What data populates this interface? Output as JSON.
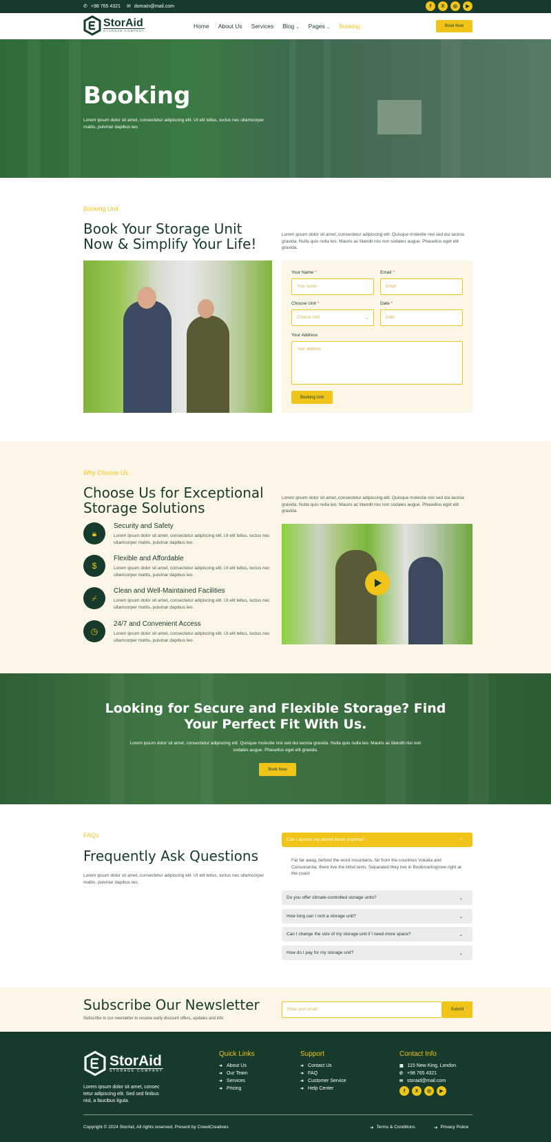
{
  "topbar": {
    "phone": "+98 765 4321",
    "email": "domain@mail.com",
    "social": [
      "facebook-icon",
      "x-icon",
      "instagram-icon",
      "youtube-icon"
    ]
  },
  "brand": {
    "name": "StorAid",
    "tagline": "STORAGE COMPANY"
  },
  "nav": {
    "items": [
      "Home",
      "About Us",
      "Services",
      "Blog",
      "Pages",
      "Booking"
    ],
    "active": "Booking",
    "cta": "Book Now"
  },
  "hero": {
    "title": "Booking",
    "text": "Lorem ipsum dolor sit amet, consectetur adipiscing elit. Ut elit tellus, luctus nec ullamcorper mattis, pulvinar dapibus leo."
  },
  "booking": {
    "kicker": "Booking Unit",
    "title_l1": "Book Your Storage Unit",
    "title_l2": "Now & Simplify Your Life!",
    "text": "Lorem ipsum dolor sit amet, consectetur adipiscing elit. Quisque molestie nisl sed dui lacinia gravida. Nulla quis nulla leo. Mauris ac blandit nisi non sodales augue. Phasellus eget elit gravida.",
    "form": {
      "name_label": "Your Name",
      "name_ph": "Your name",
      "email_label": "Email",
      "email_ph": "Email",
      "unit_label": "Choose Unit",
      "unit_ph": "Choose Unit",
      "date_label": "Date",
      "date_ph": "Date",
      "address_label": "Your Address",
      "address_ph": "Your address",
      "submit": "Booking Unit",
      "req": "*"
    }
  },
  "why": {
    "kicker": "Why Choose Us",
    "title_l1": "Choose Us for Exceptional",
    "title_l2": "Storage Solutions",
    "text": "Lorem ipsum dolor sit amet, consectetur adipiscing elit. Quisque molestie nisl sed dui lacinia gravida. Nulla quis nulla leo. Mauris ac blandit nisi non sodales augue. Phasellus eget elit gravida.",
    "features": [
      {
        "title": "Security and Safety",
        "text": "Lorem ipsum dolor sit amet, consectetur adipiscing elit. Ut elit tellus, luctus nec ullamcorper mattis, pulvinar dapibus leo.",
        "icon": "lock-icon"
      },
      {
        "title": "Flexible and Affordable",
        "text": "Lorem ipsum dolor sit amet, consectetur adipiscing elit. Ut elit tellus, luctus nec ullamcorper mattis, pulvinar dapibus leo.",
        "icon": "money-bag-icon"
      },
      {
        "title": "Clean and Well-Maintained Facilities",
        "text": "Lorem ipsum dolor sit amet, consectetur adipiscing elit. Ut elit tellus, luctus nec ullamcorper mattis, pulvinar dapibus leo.",
        "icon": "broom-icon"
      },
      {
        "title": "24/7 and Convenient Access",
        "text": "Lorem ipsum dolor sit amet, consectetur adipiscing elit. Ut elit tellus, luctus nec ullamcorper mattis, pulvinar dapibus leo.",
        "icon": "clock-icon"
      }
    ]
  },
  "cta": {
    "title_l1": "Looking for Secure and Flexible Storage? Find",
    "title_l2": "Your Perfect Fit With Us.",
    "text": "Lorem ipsum dolor sit amet, consectetur adipiscing elit. Quisque molestie nisl sed dui lacinia gravida. Nulla quis nulla leo. Mauris ac blandit nisi non sodales augue. Phasellus eget elit gravida.",
    "button": "Book Now"
  },
  "faq": {
    "kicker": "FAQs",
    "title": "Frequently Ask Questions",
    "text": "Lorem ipsum dolor sit amet, consectetur adipiscing elit. Ut elit tellus, luctus nec ullamcorper mattis, pulvinar dapibus leo.",
    "open_q": "Can I access my stored items anytime?",
    "open_a": "Far far away, behind the word mountains, far from the countries Vokalia and Consonantia, there live the blind texts. Separated they live in Bookmarksgrove right at the coast",
    "questions": [
      "Do you offer climate-controlled storage units?",
      "How long can I rent a storage unit?",
      "Can I change the size of my storage unit if I need more space?",
      "How do I pay for my storage unit?"
    ]
  },
  "newsletter": {
    "title": "Subscribe Our Newsletter",
    "text": "Subscribe to our newsletter to receive early discount offers, updates and info",
    "placeholder": "Enter your email",
    "button": "Submit"
  },
  "footer": {
    "about": "Lorem ipsum dolor sit amet, consec tetur adipiscing elit. Sed sed finibus nisl, a faucibus ligula.",
    "quick_title": "Quick Links",
    "quick": [
      "About Us",
      "Our Team",
      "Services",
      "Pricing"
    ],
    "support_title": "Support",
    "support": [
      "Contact Us",
      "FAQ",
      "Customer Service",
      "Help Center"
    ],
    "contact_title": "Contact Info",
    "address": "115 New King, London",
    "phone": "+98 765 4321",
    "email": "storaid@mail.com",
    "copyright": "Copyright © 2024 StorAid, All rights reserved. Present by CreedCreatives",
    "terms": "Terms & Conditions",
    "privacy": "Privacy Police"
  },
  "colors": {
    "accent": "#f0c419",
    "dark": "#163a2c",
    "cream": "#fbf6e6"
  }
}
